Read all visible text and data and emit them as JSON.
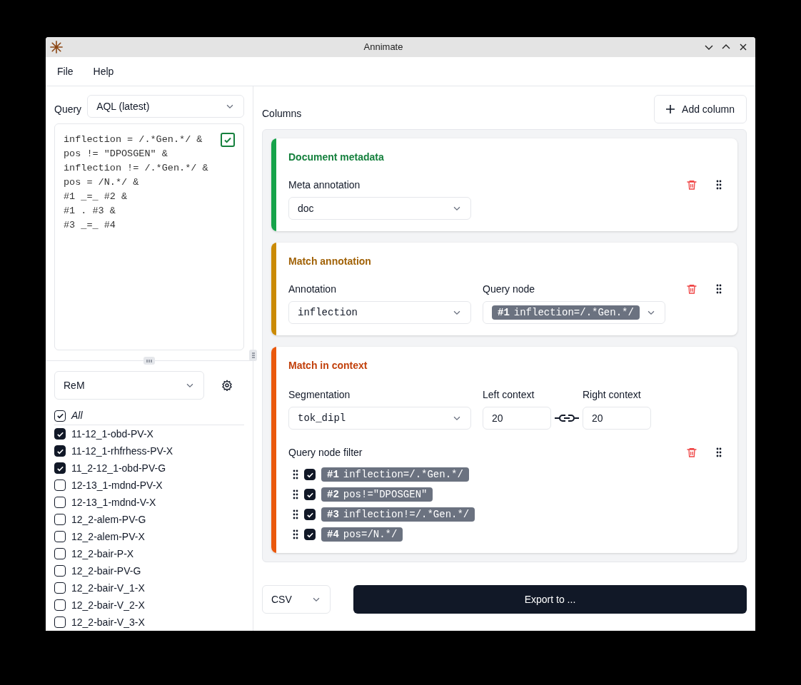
{
  "window": {
    "title": "Annimate"
  },
  "menu": [
    "File",
    "Help"
  ],
  "query": {
    "label": "Query",
    "language": "AQL (latest)",
    "text": "inflection = /.*Gen.*/ &\npos != \"DPOSGEN\" &\ninflection != /.*Gen.*/ &\npos = /N.*/ &\n#1 _=_ #2 &\n#1 . #3 &\n#3 _=_ #4",
    "valid": true
  },
  "corpus_set": "ReM",
  "corpora_all": {
    "label": "All",
    "checked": true
  },
  "corpora": [
    {
      "label": "11-12_1-obd-PV-X",
      "checked": true
    },
    {
      "label": "11-12_1-rhfrhess-PV-X",
      "checked": true
    },
    {
      "label": "11_2-12_1-obd-PV-G",
      "checked": true
    },
    {
      "label": "12-13_1-mdnd-PV-X",
      "checked": false
    },
    {
      "label": "12-13_1-mdnd-V-X",
      "checked": false
    },
    {
      "label": "12_2-alem-PV-G",
      "checked": false
    },
    {
      "label": "12_2-alem-PV-X",
      "checked": false
    },
    {
      "label": "12_2-bair-P-X",
      "checked": false
    },
    {
      "label": "12_2-bair-PV-G",
      "checked": false
    },
    {
      "label": "12_2-bair-V_1-X",
      "checked": false
    },
    {
      "label": "12_2-bair-V_2-X",
      "checked": false
    },
    {
      "label": "12_2-bair-V_3-X",
      "checked": false
    }
  ],
  "columns_label": "Columns",
  "add_column": "Add column",
  "columns": [
    {
      "kind": "metadata",
      "title": "Document metadata",
      "color": "#16a34a",
      "fields": [
        {
          "label": "Meta annotation",
          "value": "doc"
        }
      ]
    },
    {
      "kind": "annotation",
      "title": "Match annotation",
      "color": "#ca8a04",
      "fields": [
        {
          "label": "Annotation",
          "value": "inflection"
        }
      ],
      "query_node": {
        "label": "Query node",
        "id": "#1",
        "expr": "inflection=/.*Gen.*/"
      }
    },
    {
      "kind": "context",
      "title": "Match in context",
      "color": "#ea580c",
      "fields": [
        {
          "label": "Segmentation",
          "value": "tok_dipl"
        }
      ],
      "left": {
        "label": "Left context",
        "value": "20"
      },
      "right": {
        "label": "Right context",
        "value": "20"
      },
      "linked": true,
      "filter_label": "Query node filter",
      "filter": [
        {
          "id": "#1",
          "expr": "inflection=/.*Gen.*/",
          "checked": true
        },
        {
          "id": "#2",
          "expr": "pos!=\"DPOSGEN\"",
          "checked": true
        },
        {
          "id": "#3",
          "expr": "inflection!=/.*Gen.*/",
          "checked": true
        },
        {
          "id": "#4",
          "expr": "pos=/N.*/",
          "checked": true
        }
      ]
    }
  ],
  "format": "CSV",
  "export": "Export to ..."
}
